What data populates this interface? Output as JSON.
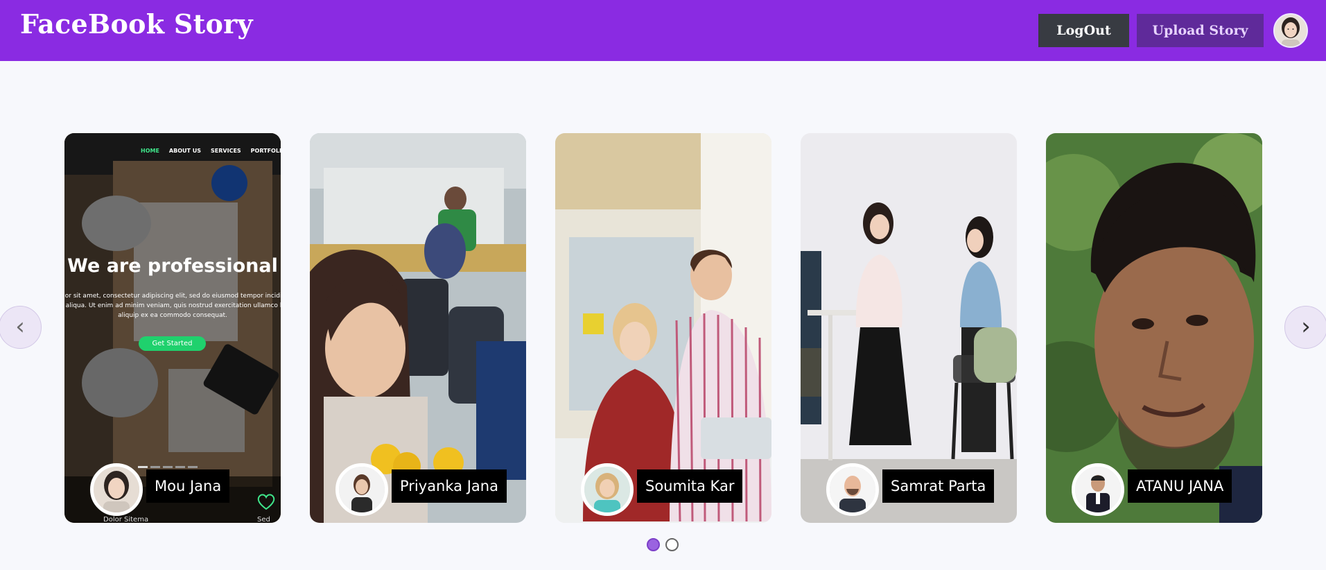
{
  "header": {
    "brand": "FaceBook Story",
    "logout_label": "LogOut",
    "upload_label": "Upload Story"
  },
  "carousel": {
    "prev_label": "‹",
    "next_label": "›",
    "stories": [
      {
        "name": "Mou Jana"
      },
      {
        "name": "Priyanka Jana"
      },
      {
        "name": "Soumita Kar"
      },
      {
        "name": "Samrat Parta"
      },
      {
        "name": "ATANU JANA"
      }
    ],
    "mock_site": {
      "nav": [
        "HOME",
        "ABOUT US",
        "SERVICES",
        "PORTFOLIO"
      ],
      "headline": "We are professional",
      "body": "olor sit amet, consectetur adipiscing elit, sed do eiusmod tempor incidid a aliqua. Ut enim ad minim veniam, quis nostrud exercitation ullamco la aliquip ex ea commodo consequat.",
      "cta": "Get Started",
      "footer_left": "Dolor Sitema",
      "footer_right": "Sed"
    },
    "pagination": {
      "total": 2,
      "active": 1
    }
  },
  "colors": {
    "header_bg": "#8a2be2",
    "logout_bg": "#383b42",
    "upload_bg": "#5f2a9a",
    "page_bg": "#f7f8fc"
  }
}
